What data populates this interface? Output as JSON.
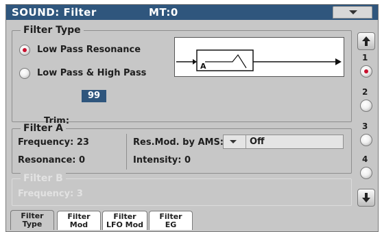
{
  "header": {
    "title": "SOUND: Filter",
    "mt": "MT:0"
  },
  "filter_type": {
    "title": "Filter Type",
    "options": [
      {
        "label": "Low Pass Resonance",
        "selected": true
      },
      {
        "label": "Low Pass & High Pass",
        "selected": false
      }
    ],
    "diagram_label": "A",
    "trim_label": "Trim:",
    "trim_value": "99"
  },
  "filter_a": {
    "title": "Filter A",
    "frequency": "Frequency: 23",
    "resonance": "Resonance: 0",
    "res_mod_label": "Res.Mod. by AMS:",
    "res_mod_value": "Off",
    "intensity": "Intensity: 0"
  },
  "filter_b": {
    "title": "Filter B",
    "frequency": "Frequency: 3"
  },
  "sidebar": {
    "items": [
      "1",
      "2",
      "3",
      "4"
    ],
    "selected_index": 0
  },
  "tabs": [
    {
      "line1": "Filter",
      "line2": "Type",
      "active": true
    },
    {
      "line1": "Filter",
      "line2": "Mod",
      "active": false
    },
    {
      "line1": "Filter",
      "line2": "LFO Mod",
      "active": false
    },
    {
      "line1": "Filter",
      "line2": "EG",
      "active": false
    }
  ],
  "colors": {
    "title_bar": "#2f567d",
    "selected_dot": "#c8102e",
    "panel_bg": "#c7c7c7"
  }
}
